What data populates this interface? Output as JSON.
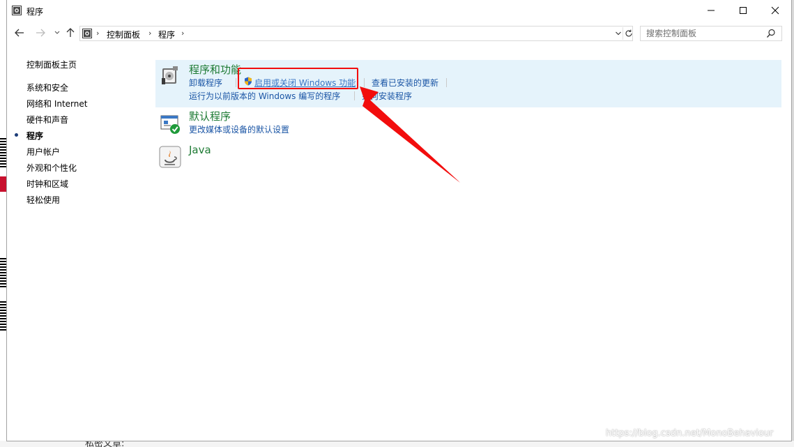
{
  "window": {
    "title": "程序",
    "controls": {
      "minimize": "minimize",
      "maximize": "maximize",
      "close": "close"
    }
  },
  "address_bar": {
    "breadcrumb": [
      "控制面板",
      "程序"
    ],
    "search_placeholder": "搜索控制面板"
  },
  "sidebar": {
    "home": "控制面板主页",
    "items": [
      {
        "label": "系统和安全",
        "active": false
      },
      {
        "label": "网络和 Internet",
        "active": false
      },
      {
        "label": "硬件和声音",
        "active": false
      },
      {
        "label": "程序",
        "active": true
      },
      {
        "label": "用户帐户",
        "active": false
      },
      {
        "label": "外观和个性化",
        "active": false
      },
      {
        "label": "时钟和区域",
        "active": false
      },
      {
        "label": "轻松使用",
        "active": false
      }
    ]
  },
  "categories": [
    {
      "title": "程序和功能",
      "links": [
        "卸载程序",
        "启用或关闭 Windows 功能",
        "查看已安装的更新",
        "运行为以前版本的 Windows 编写的程序",
        "如何安装程序"
      ]
    },
    {
      "title": "默认程序",
      "links": [
        "更改媒体或设备的默认设置"
      ]
    },
    {
      "title": "Java",
      "links": []
    }
  ],
  "background": {
    "bottom_text": "私密文章:"
  },
  "watermark": "https://blog.csdn.net/MonoBehaviour",
  "colors": {
    "category_title": "#1e7b34",
    "link": "#1a55a5",
    "highlight_bg": "#e5f3fb",
    "annotation": "#f20d0d"
  }
}
